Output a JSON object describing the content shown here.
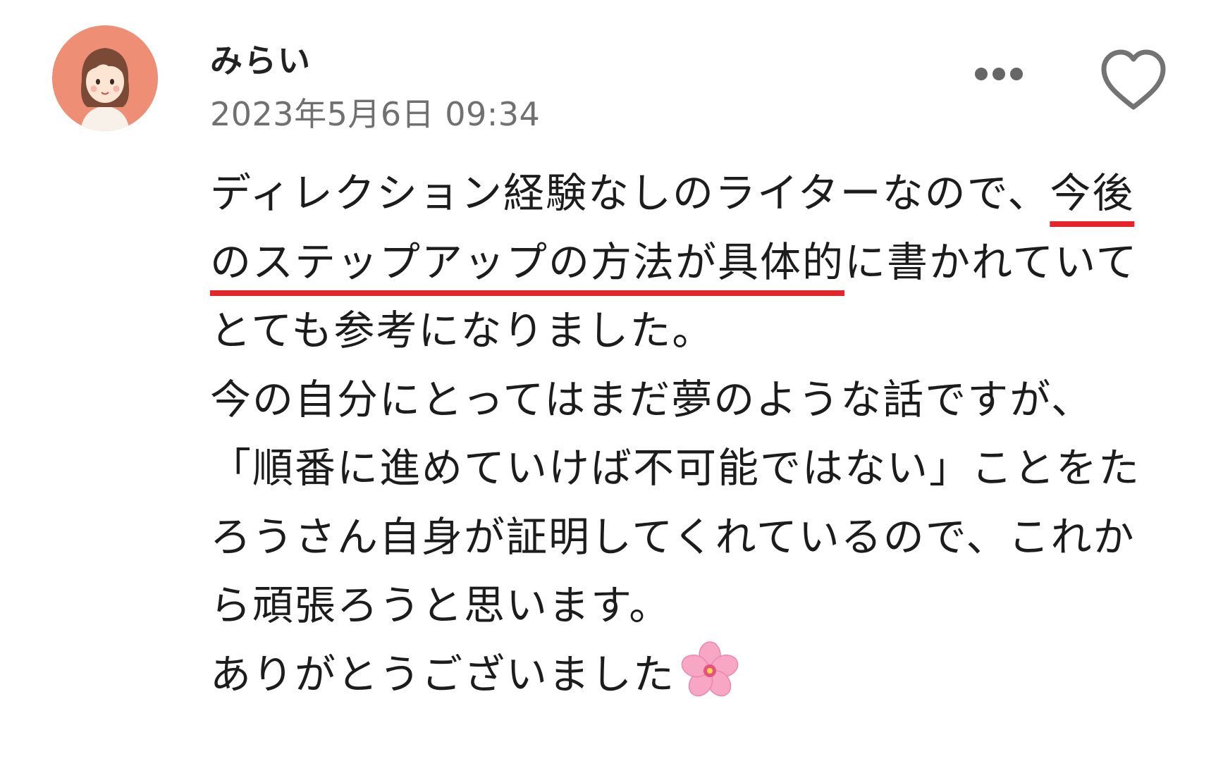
{
  "comment": {
    "author": "みらい",
    "timestamp": "2023年5月6日 09:34",
    "body": {
      "line1_a": "ディレクション経験なしのライターなので、",
      "line1_b": "今後",
      "line2_a": "のステップアップの方法が具体的",
      "line2_b": "に書かれていて",
      "line3": "とても参考になりました。",
      "line4": "今の自分にとってはまだ夢のような話ですが、",
      "line5": "「順番に進めていけば不可能ではない」ことをた",
      "line6": "ろうさん自身が証明してくれているので、これか",
      "line7": "ら頑張ろうと思います。",
      "line8": "ありがとうございました"
    },
    "emoji": "cherry-blossom",
    "highlight_color": "#e8242b"
  },
  "icons": {
    "more": "more-dots-icon",
    "like": "heart-outline-icon"
  },
  "colors": {
    "avatar_bg": "#ee8e74",
    "meta_text": "#707070"
  }
}
